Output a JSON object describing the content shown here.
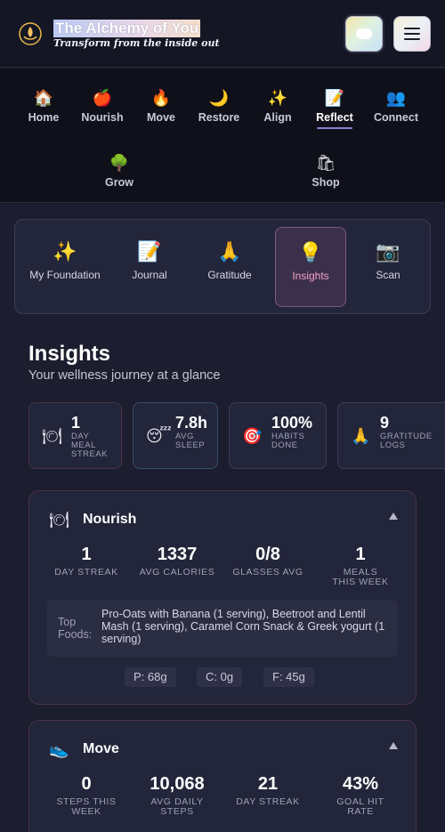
{
  "header": {
    "title": "The Alchemy of You",
    "subtitle": "Transform from the inside out",
    "logo_icon": "flame-lotus-icon",
    "chat_icon": "chat-bubble-icon",
    "menu_icon": "hamburger-icon"
  },
  "nav": {
    "items": [
      {
        "label": "Home",
        "icon": "🏠"
      },
      {
        "label": "Nourish",
        "icon": "🍎"
      },
      {
        "label": "Move",
        "icon": "🔥"
      },
      {
        "label": "Restore",
        "icon": "🌙"
      },
      {
        "label": "Align",
        "icon": "✨"
      },
      {
        "label": "Reflect",
        "icon": "📝",
        "active": true
      },
      {
        "label": "Connect",
        "icon": "👥"
      },
      {
        "label": "Grow",
        "icon": "🌳"
      },
      {
        "label": "Shop",
        "icon": "🛍"
      }
    ]
  },
  "subtabs": [
    {
      "label": "My Foundation",
      "icon": "✨"
    },
    {
      "label": "Journal",
      "icon": "📝"
    },
    {
      "label": "Gratitude",
      "icon": "🙏"
    },
    {
      "label": "Insights",
      "icon": "💡",
      "active": true
    },
    {
      "label": "Scan",
      "icon": "📷"
    }
  ],
  "insights": {
    "title": "Insights",
    "subtitle": "Your wellness journey at a glance"
  },
  "stats": [
    {
      "icon": "🍽",
      "value": "1",
      "caption": "DAY MEAL STREAK"
    },
    {
      "icon": "😴",
      "value": "7.8h",
      "caption": "AVG SLEEP"
    },
    {
      "icon": "🎯",
      "value": "100%",
      "caption": "HABITS DONE"
    },
    {
      "icon": "🙏",
      "value": "9",
      "caption": "GRATITUDE LOGS"
    }
  ],
  "nourish": {
    "icon": "🍽",
    "title": "Nourish",
    "metrics": [
      {
        "value": "1",
        "label": "DAY STREAK"
      },
      {
        "value": "1337",
        "label": "AVG CALORIES"
      },
      {
        "value": "0/8",
        "label": "GLASSES AVG"
      },
      {
        "value": "1",
        "label": "MEALS THIS WEEK"
      }
    ],
    "top_foods_label": "Top Foods:",
    "top_foods": "Pro-Oats with Banana (1 serving), Beetroot and Lentil Mash (1 serving), Caramel Corn Snack & Greek yogurt (1 serving)",
    "macros": [
      "P: 68g",
      "C: 0g",
      "F: 45g"
    ]
  },
  "move": {
    "icon": "👟",
    "title": "Move",
    "metrics": [
      {
        "value": "0",
        "label": "STEPS THIS WEEK"
      },
      {
        "value": "10,068",
        "label": "AVG DAILY STEPS"
      },
      {
        "value": "21",
        "label": "DAY STREAK"
      },
      {
        "value": "43%",
        "label": "GOAL HIT RATE"
      }
    ]
  },
  "colors": {
    "background": "#1c1d2e",
    "accent": "#8a7fd6",
    "active_tab": "#f4a3c8"
  }
}
